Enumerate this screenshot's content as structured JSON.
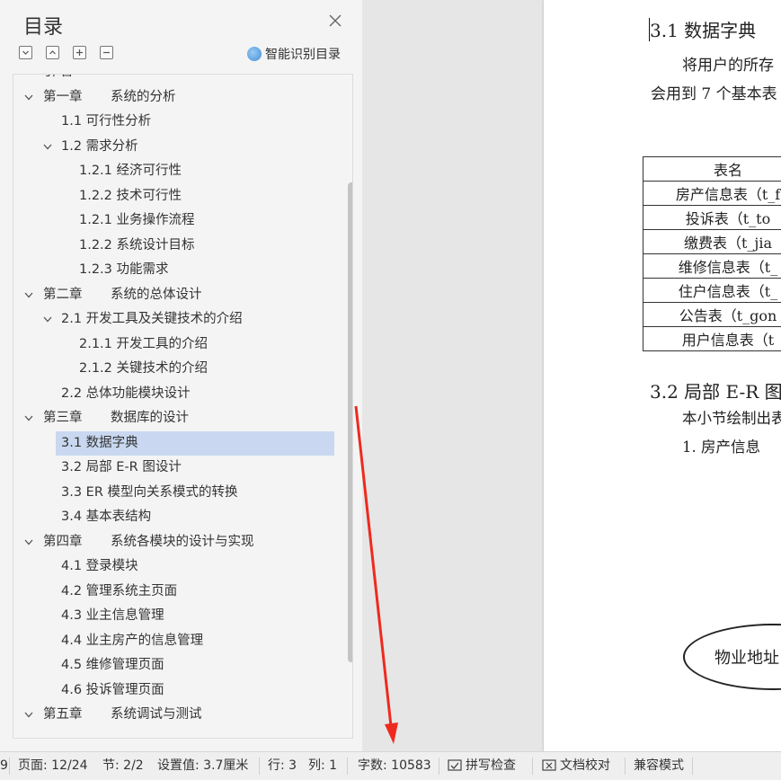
{
  "toc": {
    "title": "目录",
    "smart_label": "智能识别目录",
    "items": [
      {
        "label": "引 言",
        "level": 0,
        "chevron": false
      },
      {
        "num": "第一章",
        "label": "系统的分析",
        "level": 0,
        "chevron": true
      },
      {
        "label": "1.1 可行性分析",
        "level": 1,
        "chevron": false
      },
      {
        "label": "1.2 需求分析",
        "level": 1,
        "chevron": true
      },
      {
        "label": "1.2.1  经济可行性",
        "level": 2,
        "chevron": false
      },
      {
        "label": "1.2.2  技术可行性",
        "level": 2,
        "chevron": false
      },
      {
        "label": "1.2.1 业务操作流程",
        "level": 2,
        "chevron": false
      },
      {
        "label": "1.2.2 系统设计目标",
        "level": 2,
        "chevron": false
      },
      {
        "label": "1.2.3 功能需求",
        "level": 2,
        "chevron": false
      },
      {
        "num": "第二章",
        "label": "系统的总体设计",
        "level": 0,
        "chevron": true
      },
      {
        "label": "2.1 开发工具及关键技术的介绍",
        "level": 1,
        "chevron": true
      },
      {
        "label": "2.1.1 开发工具的介绍",
        "level": 2,
        "chevron": false
      },
      {
        "label": "2.1.2 关键技术的介绍",
        "level": 2,
        "chevron": false
      },
      {
        "label": "2.2 总体功能模块设计",
        "level": 1,
        "chevron": false
      },
      {
        "num": "第三章",
        "label": "数据库的设计",
        "level": 0,
        "chevron": true
      },
      {
        "label": "3.1 数据字典",
        "level": 1,
        "chevron": false,
        "selected": true
      },
      {
        "label": "3.2 局部 E-R 图设计",
        "level": 1,
        "chevron": false
      },
      {
        "label": "3.3 ER 模型向关系模式的转换",
        "level": 1,
        "chevron": false
      },
      {
        "label": "3.4 基本表结构",
        "level": 1,
        "chevron": false
      },
      {
        "num": "第四章",
        "label": "系统各模块的设计与实现",
        "level": 0,
        "chevron": true
      },
      {
        "label": "4.1 登录模块",
        "level": 1,
        "chevron": false
      },
      {
        "label": "4.2 管理系统主页面",
        "level": 1,
        "chevron": false
      },
      {
        "label": "4.3 业主信息管理",
        "level": 1,
        "chevron": false
      },
      {
        "label": "4.4 业主房产的信息管理",
        "level": 1,
        "chevron": false
      },
      {
        "label": "4.5 维修管理页面",
        "level": 1,
        "chevron": false
      },
      {
        "label": "4.6 投诉管理页面",
        "level": 1,
        "chevron": false
      },
      {
        "num": "第五章",
        "label": "系统调试与测试",
        "level": 0,
        "chevron": true
      }
    ]
  },
  "document": {
    "section_31": "3.1 数据字典",
    "para_1": "将用户的所存",
    "para_2": "会用到 7 个基本表",
    "table_rows": [
      "表名",
      "房产信息表（t_f",
      "投诉表（t_to",
      "缴费表（t_jia",
      "维修信息表（t_",
      "住户信息表（t_",
      "公告表（t_gon",
      "用户信息表（t"
    ],
    "section_32": "3.2 局部 E-R 图",
    "para_3": "本小节绘制出表",
    "para_4": "1.  房产信息",
    "er_label": "物业地址"
  },
  "status_bar": {
    "partial": "9",
    "page": "页面: 12/24",
    "section": "节: 2/2",
    "setting": "设置值: 3.7厘米",
    "row": "行: 3",
    "col": "列: 1",
    "word_count": "字数: 10583",
    "spell_check": "拼写检查",
    "doc_proof": "文档校对",
    "compat_mode": "兼容模式"
  },
  "colors": {
    "selected_bg": "#c9d8f0",
    "arrow": "#ee2a1e"
  }
}
